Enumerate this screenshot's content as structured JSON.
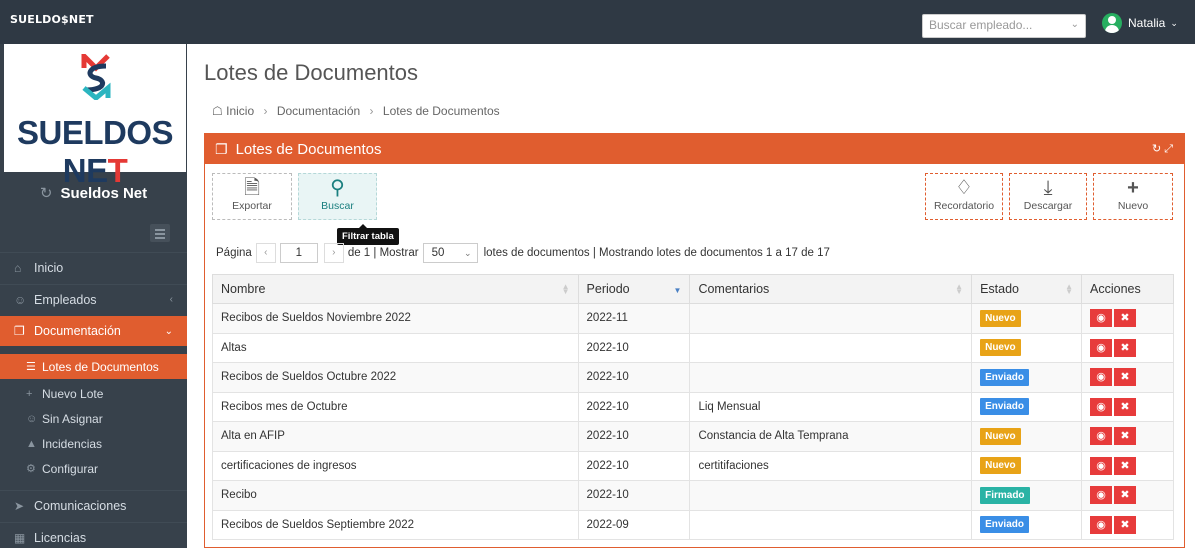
{
  "topbar": {
    "brand": "SUELDO$NET",
    "employee_search_placeholder": "Buscar empleado...",
    "user_name": "Natalia"
  },
  "sidebar": {
    "logo_text_main": "SUELDOS NE",
    "logo_text_last": "T",
    "title": "Sueldos Net",
    "items": [
      {
        "label": "Inicio",
        "icon": "home-icon"
      },
      {
        "label": "Empleados",
        "icon": "users-icon"
      },
      {
        "label": "Documentación",
        "icon": "documents-icon"
      }
    ],
    "subitems": [
      {
        "label": "Lotes de Documentos",
        "icon": "list-icon"
      },
      {
        "label": "Nuevo Lote",
        "icon": "plus-icon"
      },
      {
        "label": "Sin Asignar",
        "icon": "user-unassigned-icon"
      },
      {
        "label": "Incidencias",
        "icon": "warning-icon"
      },
      {
        "label": "Configurar",
        "icon": "gears-icon"
      }
    ],
    "bottom_items": [
      {
        "label": "Comunicaciones",
        "icon": "send-icon"
      },
      {
        "label": "Licencias",
        "icon": "calendar-icon"
      }
    ]
  },
  "main": {
    "title": "Lotes de Documentos",
    "breadcrumb": [
      "Inicio",
      "Documentación",
      "Lotes de Documentos"
    ],
    "panel_title": "Lotes de Documentos"
  },
  "toolbar": {
    "export": "Exportar",
    "search": "Buscar",
    "tooltip": "Filtrar tabla",
    "reminder": "Recordatorio",
    "download": "Descargar",
    "new": "Nuevo"
  },
  "pager": {
    "page_label": "Página",
    "page_value": "1",
    "of_text": "de 1 | Mostrar",
    "page_size": "50",
    "summary": "lotes de documentos | Mostrando lotes de documentos 1 a 17 de 17"
  },
  "table": {
    "headers": [
      "Nombre",
      "Periodo",
      "Comentarios",
      "Estado",
      "Acciones"
    ],
    "rows": [
      {
        "nombre": "Recibos de Sueldos Noviembre 2022",
        "periodo": "2022-11",
        "comentarios": "",
        "estado": "Nuevo"
      },
      {
        "nombre": "Altas",
        "periodo": "2022-10",
        "comentarios": "",
        "estado": "Nuevo"
      },
      {
        "nombre": "Recibos de Sueldos Octubre 2022",
        "periodo": "2022-10",
        "comentarios": "",
        "estado": "Enviado"
      },
      {
        "nombre": "Recibos mes de Octubre",
        "periodo": "2022-10",
        "comentarios": "Liq Mensual",
        "estado": "Enviado"
      },
      {
        "nombre": "Alta en AFIP",
        "periodo": "2022-10",
        "comentarios": "Constancia de Alta Temprana",
        "estado": "Nuevo"
      },
      {
        "nombre": "certificaciones de ingresos",
        "periodo": "2022-10",
        "comentarios": "certitifaciones",
        "estado": "Nuevo"
      },
      {
        "nombre": "Recibo",
        "periodo": "2022-10",
        "comentarios": "",
        "estado": "Firmado"
      },
      {
        "nombre": "Recibos de Sueldos Septiembre 2022",
        "periodo": "2022-09",
        "comentarios": "",
        "estado": "Enviado"
      }
    ]
  },
  "colors": {
    "accent": "#e05d2f",
    "sidebar_bg": "#37414b",
    "topbar_bg": "#2f3944",
    "nuevo": "#e8a317",
    "enviado": "#3a8ee6",
    "firmado": "#2ab3a5",
    "action": "#e73b3b"
  }
}
